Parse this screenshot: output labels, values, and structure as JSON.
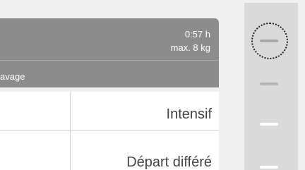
{
  "program": {
    "duration": "0:57 h",
    "max_load": "max. 8 kg",
    "subtitle": "avage"
  },
  "options": [
    {
      "label": "Intensif"
    },
    {
      "label": "Départ différé"
    }
  ],
  "rail": {
    "items": [
      {
        "name": "dash-1",
        "selected": true
      },
      {
        "name": "dash-2",
        "selected": false
      },
      {
        "name": "dash-3",
        "selected": false
      },
      {
        "name": "dash-4",
        "selected": false
      }
    ]
  },
  "colors": {
    "header_bg": "#8c8c8c",
    "rail_bg": "#dadada",
    "page_bg": "#f0f0f0"
  }
}
